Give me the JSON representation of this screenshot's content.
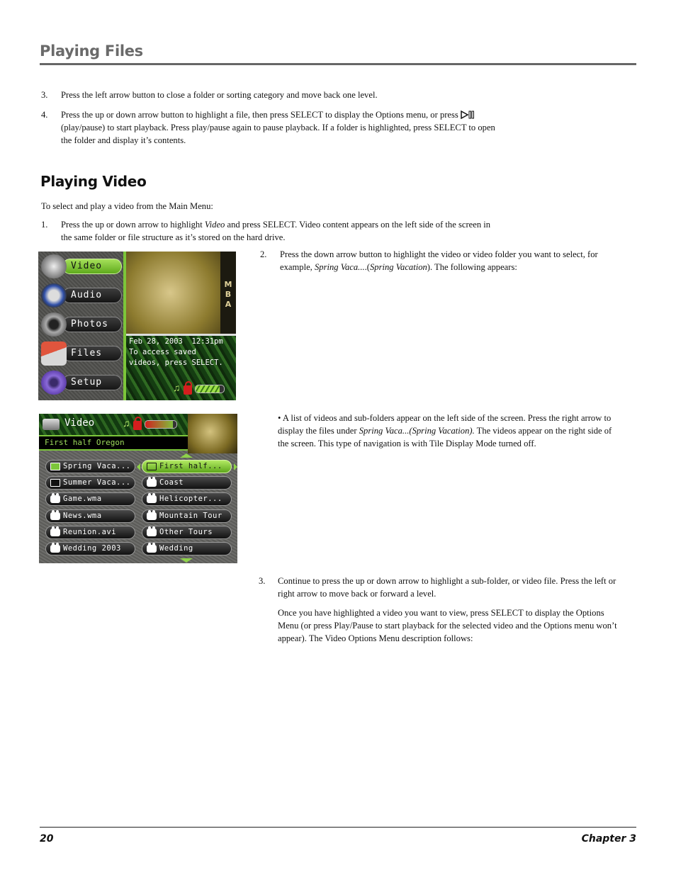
{
  "header": {
    "title": "Playing Files"
  },
  "intro_steps": [
    {
      "num": "3.",
      "text": "Press the left arrow button to close a folder or sorting category and move back one level."
    },
    {
      "num": "4.",
      "text_before": "Press the up or down arrow button to highlight a file, then press SELECT to display the Options menu, or  press ",
      "icon": "play-pause-icon",
      "text_line2": "(play/pause) to start playback. Press play/pause again to pause playback. If a folder is highlighted, press SELECT to open",
      "text_line3": "the folder and display it’s contents."
    }
  ],
  "section": {
    "title": "Playing Video",
    "lead": "To select and play a video from the Main Menu:",
    "step1": {
      "num": "1.",
      "line1_a": "Press the up or down arrow to highlight ",
      "line1_em": "Video",
      "line1_b": " and press SELECT. Video content appears on the left side of the screen in",
      "line2": "the same folder or file structure as it’s stored on the hard drive."
    },
    "step2": {
      "num": "2.",
      "line1": "Press the down arrow button to highlight the video or video folder you want to select, for",
      "line2_a": "example, ",
      "line2_em1": "Spring Vaca...",
      "line2_b": ".(",
      "line2_em2": "Spring Vacation",
      "line2_c": "). The following appears:"
    },
    "bullet": {
      "mark": "•",
      "line1": "  A list of videos and sub-folders appear on the left side of the screen. Press the right arrow to",
      "line2_a": "display the files under ",
      "line2_em": "Spring Vaca...(Spring Vacation).",
      "line2_b": " The videos appear on the right side of",
      "line3": "the screen. This type of navigation is with Tile Display Mode turned off."
    },
    "step3": {
      "num": "3.",
      "line1": "Continue to press the up or down arrow to highlight a sub-folder, or video file. Press the left or",
      "line2": "right arrow to move back or forward a level.",
      "p2_line1": "Once you have highlighted a video you want to view, press SELECT to display the Options",
      "p2_line2": "Menu (or press Play/Pause to start playback for the selected video and the Options menu won’t",
      "p2_line3": "appear). The Video Options Menu description follows:"
    }
  },
  "screen_main_menu": {
    "menu": [
      {
        "label": "Video",
        "icon": "camcorder-icon",
        "active": true
      },
      {
        "label": "Audio",
        "icon": "headphones-icon",
        "active": false
      },
      {
        "label": "Photos",
        "icon": "camera-icon",
        "active": false
      },
      {
        "label": "Files",
        "icon": "folder-icon",
        "active": false
      },
      {
        "label": "Setup",
        "icon": "gear-icon",
        "active": false
      }
    ],
    "film_letters": [
      "M",
      "B",
      "A"
    ],
    "datetime": "Feb 28, 2003  12:31pm",
    "message_line1": "To access saved",
    "message_line2": "videos, press SELECT.",
    "battery_level": 0.85,
    "colors": {
      "accent": "#7cc63a",
      "lock": "#d41e1e"
    }
  },
  "screen_video_browser": {
    "title": "Video",
    "current_path": "First half Oregon",
    "battery_level": 0.9,
    "left_list": [
      {
        "label": "Spring Vaca...",
        "type": "folder-open"
      },
      {
        "label": "Summer Vaca...",
        "type": "folder"
      },
      {
        "label": "Game.wma",
        "type": "video"
      },
      {
        "label": "News.wma",
        "type": "video"
      },
      {
        "label": "Reunion.avi",
        "type": "video"
      },
      {
        "label": "Wedding 2003",
        "type": "video"
      }
    ],
    "right_list": [
      {
        "label": "First half...",
        "type": "folder",
        "active": true
      },
      {
        "label": "Coast",
        "type": "video"
      },
      {
        "label": "Helicopter...",
        "type": "video"
      },
      {
        "label": "Mountain Tour",
        "type": "video"
      },
      {
        "label": "Other Tours",
        "type": "video"
      },
      {
        "label": "Wedding",
        "type": "video"
      }
    ]
  },
  "footer": {
    "page": "20",
    "chapter": "Chapter 3"
  }
}
